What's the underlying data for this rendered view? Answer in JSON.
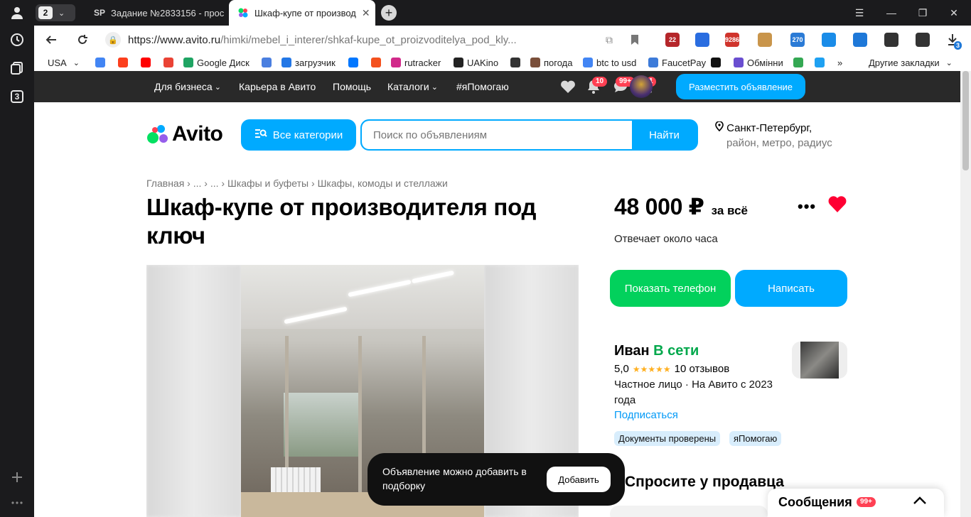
{
  "browser": {
    "tab_count": "2",
    "tabs": [
      {
        "title": "Задание №2833156 - прос",
        "favicon": "SP"
      },
      {
        "title": "Шкаф-купе от производ",
        "favicon": "avito-dots"
      }
    ],
    "url_host": "https://www.avito.ru",
    "url_path": "/himki/mebel_i_interer/shkaf-kupe_ot_proizvoditelya_pod_kly...",
    "extensions": [
      {
        "icon": "ext-shield-icon",
        "label": "22",
        "color": "#b5262a"
      },
      {
        "icon": "ext-globe-icon",
        "label": "",
        "color": "#2a6de0"
      },
      {
        "icon": "ext-counter-icon",
        "label": "9286",
        "color": "#d0342c"
      },
      {
        "icon": "ext-box-icon",
        "label": "",
        "color": "#c9954b"
      },
      {
        "icon": "ext-calendar-icon",
        "label": "270",
        "color": "#2b7bd6"
      },
      {
        "icon": "ext-diamond-icon",
        "label": "",
        "color": "#1a8ce8"
      },
      {
        "icon": "ext-download-icon",
        "label": "",
        "color": "#1e78d8"
      },
      {
        "icon": "ext-arrow-icon",
        "label": "",
        "color": "#333333"
      },
      {
        "icon": "ext-copy-icon",
        "label": "",
        "color": "#333333"
      }
    ],
    "downloads_badge": "3",
    "rail_counter": "3"
  },
  "bookmarks": [
    {
      "label": "USA",
      "icon": "chevron-down-icon",
      "color": "#ffffff"
    },
    {
      "label": "",
      "icon": "google-icon",
      "color": "#4285f4"
    },
    {
      "label": "",
      "icon": "yandex-icon",
      "color": "#fc3f1d"
    },
    {
      "label": "",
      "icon": "youtube-icon",
      "color": "#ff0000"
    },
    {
      "label": "",
      "icon": "gmail-icon",
      "color": "#ea4335"
    },
    {
      "label": "Google Диск",
      "icon": "drive-icon",
      "color": "#1fa463"
    },
    {
      "label": "",
      "icon": "translate-icon",
      "color": "#4a7fe0"
    },
    {
      "label": "загрузчик",
      "icon": "infinity-icon",
      "color": "#2377e6"
    },
    {
      "label": "",
      "icon": "vk-icon",
      "color": "#0077ff"
    },
    {
      "label": "",
      "icon": "f-icon",
      "color": "#f4511e"
    },
    {
      "label": "rutracker",
      "icon": "flower-icon",
      "color": "#d12a8a"
    },
    {
      "label": "UAKino",
      "icon": "ua-icon",
      "color": "#222222"
    },
    {
      "label": "",
      "icon": "chess-icon",
      "color": "#333333"
    },
    {
      "label": "погода",
      "icon": "thermometer-icon",
      "color": "#7a4f3a"
    },
    {
      "label": "btc to usd",
      "icon": "google-icon",
      "color": "#4285f4"
    },
    {
      "label": "FaucetPay",
      "icon": "faucet-icon",
      "color": "#3d7bd9"
    },
    {
      "label": "",
      "icon": "bc-icon",
      "color": "#111111"
    },
    {
      "label": "Обмінни",
      "icon": "exchange-icon",
      "color": "#6a4ed0"
    },
    {
      "label": "",
      "icon": "maps-icon",
      "color": "#34a853"
    },
    {
      "label": "",
      "icon": "sparkle-icon",
      "color": "#1ea1f2"
    },
    {
      "label": "»",
      "icon": "",
      "color": "#ffffff"
    },
    {
      "label": "Другие закладки",
      "icon": "chevron-down-icon",
      "color": "#ffffff"
    }
  ],
  "avito_header": {
    "nav": [
      "Для бизнеса",
      "Карьера в Авито",
      "Помощь",
      "Каталоги",
      "#яПомогаю"
    ],
    "notifications_badge": "10",
    "messages_badge": "99+",
    "cart_badge": "1",
    "post_button": "Разместить объявление"
  },
  "search": {
    "logo_text": "Avito",
    "categories_button": "Все категории",
    "placeholder": "Поиск по объявлениям",
    "find_button": "Найти",
    "city": "Санкт-Петербург,",
    "location_sub": "район, метро, радиус"
  },
  "listing": {
    "breadcrumb": [
      "Главная",
      "...",
      "...",
      "Шкафы и буфеты",
      "Шкафы, комоды и стеллажи"
    ],
    "title": "Шкаф-купе от производителя под ключ",
    "price": "48 000 ₽",
    "price_suffix": "за всё",
    "response_time": "Отвечает около часа",
    "show_phone_button": "Показать телефон",
    "write_button": "Написать"
  },
  "seller": {
    "name": "Иван",
    "online": "В сети",
    "rating": "5,0",
    "stars": "★★★★★",
    "reviews": "10 отзывов",
    "info": "Частное лицо · На Авито с 2023 года",
    "subscribe": "Подписаться",
    "chips": [
      "Документы проверены",
      "яПомогаю"
    ],
    "ask_title": "Спросите у продавца"
  },
  "toast": {
    "message": "Объявление можно добавить в подборку",
    "button": "Добавить"
  },
  "messenger": {
    "label": "Сообщения",
    "badge": "99+"
  },
  "colors": {
    "accent_blue": "#00aaff",
    "green": "#02d15c",
    "online_green": "#02a84c",
    "heart_red": "#ff0033",
    "dark_header": "#292929"
  }
}
